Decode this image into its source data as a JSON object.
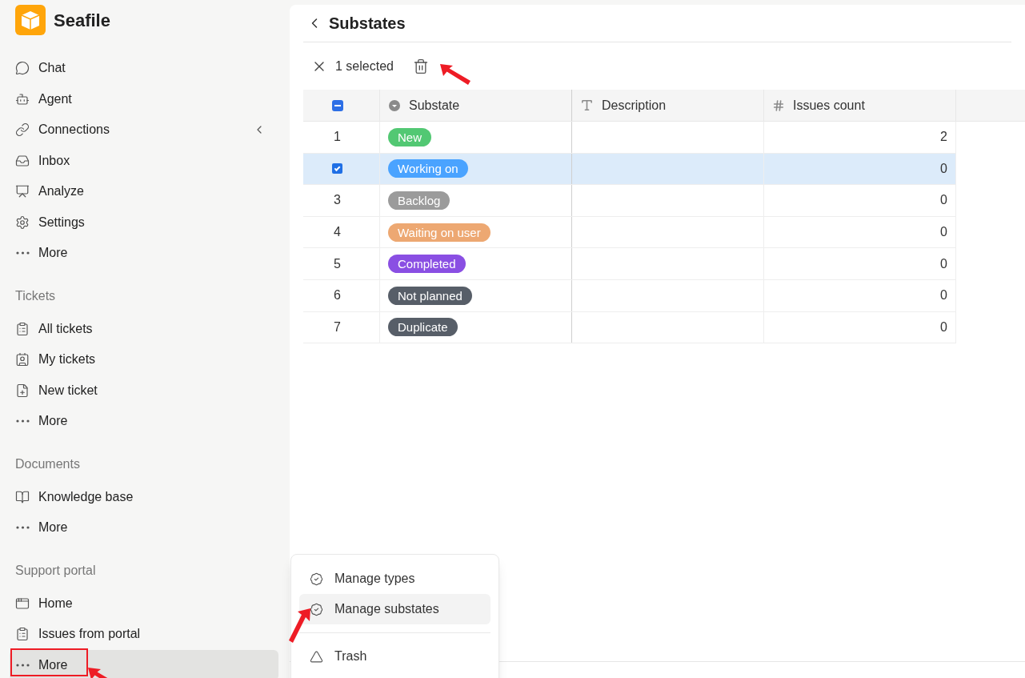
{
  "app": {
    "name": "Seafile"
  },
  "sidebar": {
    "sections": [
      {
        "items": [
          {
            "label": "Chat",
            "selected": false
          },
          {
            "label": "Agent",
            "selected": false
          },
          {
            "label": "Connections",
            "selected": false
          },
          {
            "label": "Inbox",
            "selected": false
          },
          {
            "label": "Analyze",
            "selected": false
          },
          {
            "label": "Settings",
            "selected": false
          },
          {
            "label": "More",
            "selected": false
          }
        ]
      },
      {
        "title": "Tickets",
        "items": [
          {
            "label": "All tickets",
            "selected": false
          },
          {
            "label": "My tickets",
            "selected": false
          },
          {
            "label": "New ticket",
            "selected": false
          },
          {
            "label": "More",
            "selected": false
          }
        ]
      },
      {
        "title": "Documents",
        "items": [
          {
            "label": "Knowledge base",
            "selected": false
          },
          {
            "label": "More",
            "selected": false
          }
        ]
      },
      {
        "title": "Support portal",
        "items": [
          {
            "label": "Home",
            "selected": false
          },
          {
            "label": "Issues from portal",
            "selected": false
          },
          {
            "label": "More",
            "selected": true
          }
        ]
      }
    ]
  },
  "page": {
    "title": "Substates"
  },
  "toolbar": {
    "selection": "1 selected"
  },
  "table": {
    "header_indeterminate": true,
    "columns": [
      {
        "label": "Substate",
        "kind": "select"
      },
      {
        "label": "Description",
        "kind": "text"
      },
      {
        "label": "Issues count",
        "kind": "number"
      }
    ],
    "rows": [
      {
        "index": "1",
        "selected": false,
        "substate": "New",
        "color": "#52c873",
        "count": "2"
      },
      {
        "selected": true,
        "substate": "Working on",
        "color": "#4aa3ff",
        "count": "0"
      },
      {
        "index": "3",
        "selected": false,
        "substate": "Backlog",
        "color": "#9b9b9b",
        "count": "0"
      },
      {
        "index": "4",
        "selected": false,
        "substate": "Waiting on user",
        "color": "#eda872",
        "count": "0"
      },
      {
        "index": "5",
        "selected": false,
        "substate": "Completed",
        "color": "#8a4fe3",
        "count": "0"
      },
      {
        "index": "6",
        "selected": false,
        "substate": "Not planned",
        "color": "#575e68",
        "count": "0"
      },
      {
        "index": "7",
        "selected": false,
        "substate": "Duplicate",
        "color": "#575e68",
        "count": "0"
      }
    ]
  },
  "menu": {
    "items": [
      {
        "label": "Manage types",
        "selected": false
      },
      {
        "label": "Manage substates",
        "selected": true
      },
      {
        "label": "Trash",
        "selected": false
      }
    ]
  }
}
